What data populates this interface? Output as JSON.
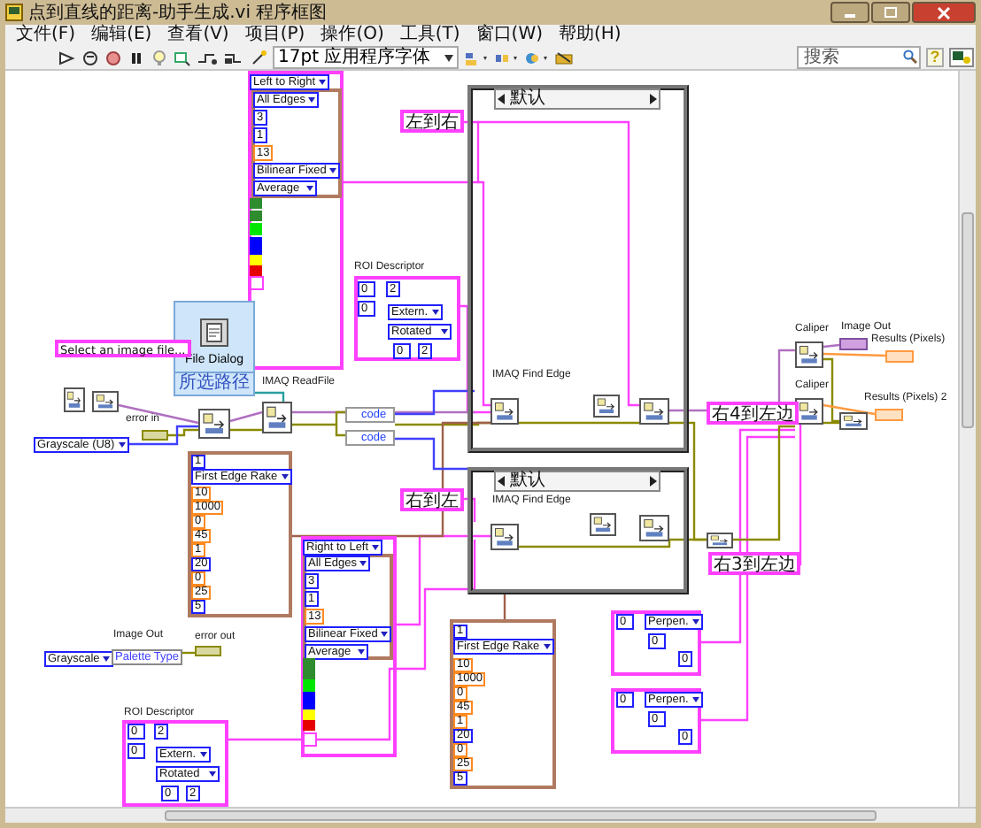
{
  "window": {
    "title": "点到直线的距离-助手生成.vi 程序框图"
  },
  "menu": [
    "文件(F)",
    "编辑(E)",
    "查看(V)",
    "项目(P)",
    "操作(O)",
    "工具(T)",
    "窗口(W)",
    "帮助(H)"
  ],
  "toolbar": {
    "font": "17pt 应用程序字体",
    "search_placeholder": "搜索",
    "help": "?"
  },
  "express_vi": {
    "title": "File Dialog",
    "output": "所选路径"
  },
  "diagram": {
    "items": [
      {
        "kind": "enum",
        "text": "Left to Right"
      },
      {
        "kind": "enum",
        "text": "All Edges"
      },
      {
        "kind": "integer",
        "text": "3"
      },
      {
        "kind": "integer",
        "text": "1"
      },
      {
        "kind": "float",
        "text": "13"
      },
      {
        "kind": "enum",
        "text": "Bilinear Fixed"
      },
      {
        "kind": "enum",
        "text": "Average"
      },
      {
        "kind": "color",
        "color": "#2e8b2e"
      },
      {
        "kind": "color",
        "color": "#2e8b2e"
      },
      {
        "kind": "color",
        "color": "#00e600"
      },
      {
        "kind": "color",
        "color": "#0000ff"
      },
      {
        "kind": "color",
        "color": "#ffff00"
      },
      {
        "kind": "color",
        "color": "#e60000"
      },
      {
        "kind": "string",
        "text": "左到右"
      },
      {
        "kind": "label",
        "text": "ROI Descriptor"
      },
      {
        "kind": "integer",
        "text": "0"
      },
      {
        "kind": "integer",
        "text": "2"
      },
      {
        "kind": "integer",
        "text": "0"
      },
      {
        "kind": "enum",
        "text": "Extern."
      },
      {
        "kind": "enum",
        "text": "Rotated"
      },
      {
        "kind": "string",
        "text": "Select an image file..."
      },
      {
        "kind": "integer",
        "text": "0"
      },
      {
        "kind": "integer",
        "text": "2"
      },
      {
        "kind": "label",
        "text": "IMAQ ReadFile"
      },
      {
        "kind": "label",
        "text": "error in"
      },
      {
        "kind": "enum",
        "text": "Grayscale (U8)"
      },
      {
        "kind": "unbundle",
        "text": "code"
      },
      {
        "kind": "unbundle",
        "text": "code"
      },
      {
        "kind": "selector",
        "text": "默认"
      },
      {
        "kind": "label",
        "text": "IMAQ Find Edge"
      },
      {
        "kind": "selector",
        "text": "默认"
      },
      {
        "kind": "label",
        "text": "IMAQ Find Edge"
      },
      {
        "kind": "string",
        "text": "右4到左边"
      },
      {
        "kind": "string",
        "text": "右3到左边"
      },
      {
        "kind": "label",
        "text": "Caliper"
      },
      {
        "kind": "label",
        "text": "Caliper"
      },
      {
        "kind": "label",
        "text": "Image Out"
      },
      {
        "kind": "label",
        "text": "Results (Pixels)"
      },
      {
        "kind": "label",
        "text": "Results (Pixels) 2"
      },
      {
        "kind": "string",
        "text": "右到左"
      },
      {
        "kind": "integer",
        "text": "1"
      },
      {
        "kind": "enum",
        "text": "First Edge Rake"
      },
      {
        "kind": "float",
        "text": "10"
      },
      {
        "kind": "float",
        "text": "1000"
      },
      {
        "kind": "float",
        "text": "0"
      },
      {
        "kind": "float",
        "text": "45"
      },
      {
        "kind": "float",
        "text": "1"
      },
      {
        "kind": "integer",
        "text": "20"
      },
      {
        "kind": "float",
        "text": "0"
      },
      {
        "kind": "float",
        "text": "25"
      },
      {
        "kind": "integer",
        "text": "5"
      },
      {
        "kind": "enum",
        "text": "Right to Left"
      },
      {
        "kind": "enum",
        "text": "All Edges"
      },
      {
        "kind": "integer",
        "text": "3"
      },
      {
        "kind": "integer",
        "text": "1"
      },
      {
        "kind": "float",
        "text": "13"
      },
      {
        "kind": "enum",
        "text": "Bilinear Fixed"
      },
      {
        "kind": "enum",
        "text": "Average"
      },
      {
        "kind": "color",
        "color": "#2e8b2e"
      },
      {
        "kind": "color",
        "color": "#2e8b2e"
      },
      {
        "kind": "color",
        "color": "#00e600"
      },
      {
        "kind": "color",
        "color": "#0000ff"
      },
      {
        "kind": "color",
        "color": "#ffff00"
      },
      {
        "kind": "color",
        "color": "#e60000"
      },
      {
        "kind": "integer",
        "text": "1"
      },
      {
        "kind": "enum",
        "text": "First Edge Rake"
      },
      {
        "kind": "float",
        "text": "10"
      },
      {
        "kind": "float",
        "text": "1000"
      },
      {
        "kind": "float",
        "text": "0"
      },
      {
        "kind": "float",
        "text": "45"
      },
      {
        "kind": "float",
        "text": "1"
      },
      {
        "kind": "integer",
        "text": "20"
      },
      {
        "kind": "float",
        "text": "0"
      },
      {
        "kind": "float",
        "text": "25"
      },
      {
        "kind": "integer",
        "text": "5"
      },
      {
        "kind": "label",
        "text": "Image Out"
      },
      {
        "kind": "enum",
        "text": "Grayscale"
      },
      {
        "kind": "indicator",
        "text": "Palette Type"
      },
      {
        "kind": "label",
        "text": "error out"
      },
      {
        "kind": "label",
        "text": "ROI Descriptor"
      },
      {
        "kind": "integer",
        "text": "0"
      },
      {
        "kind": "integer",
        "text": "2"
      },
      {
        "kind": "integer",
        "text": "0"
      },
      {
        "kind": "enum",
        "text": "Extern."
      },
      {
        "kind": "enum",
        "text": "Rotated"
      },
      {
        "kind": "integer",
        "text": "0"
      },
      {
        "kind": "integer",
        "text": "2"
      },
      {
        "kind": "integer",
        "text": "0"
      },
      {
        "kind": "enum",
        "text": "Perpen."
      },
      {
        "kind": "integer",
        "text": "0"
      },
      {
        "kind": "integer",
        "text": "0"
      },
      {
        "kind": "integer",
        "text": "0"
      },
      {
        "kind": "enum",
        "text": "Perpen."
      },
      {
        "kind": "integer",
        "text": "0"
      },
      {
        "kind": "integer",
        "text": "0"
      }
    ]
  }
}
